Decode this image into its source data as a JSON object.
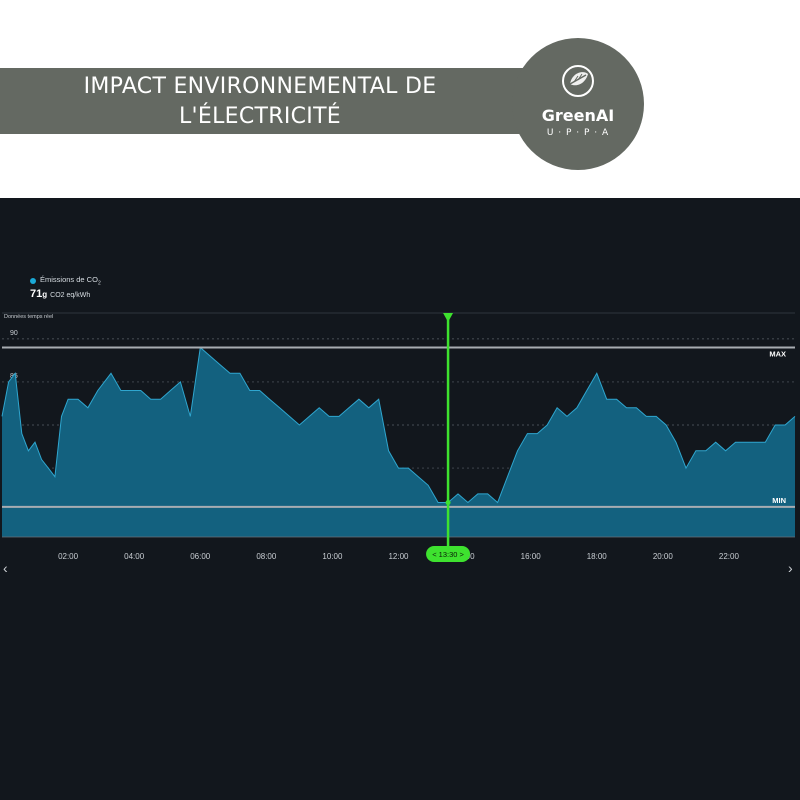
{
  "header": {
    "title_line1": "IMPACT ENVIRONNEMENTAL DE",
    "title_line2": "L'ÉLECTRICITÉ"
  },
  "logo": {
    "name": "GreenAI",
    "sub": "U · P · P · A",
    "icon": "leaf-globe-icon"
  },
  "legend": {
    "label": "Émissions de CO",
    "label_sub": "2",
    "value": "71",
    "value_unit_g": "g",
    "unit": "CO2 eq/kWh",
    "color": "#1aa9d6"
  },
  "live_label": "Données temps réel",
  "nav": {
    "prev": "‹",
    "next": "›"
  },
  "chart_data": {
    "type": "area",
    "title": "",
    "ylabel": "",
    "xlabel": "",
    "ylim": [
      67,
      93
    ],
    "xlim": [
      0,
      24
    ],
    "yticks": [
      70,
      75,
      80,
      85,
      90
    ],
    "xticks": [
      {
        "x": 2,
        "label": "02:00"
      },
      {
        "x": 4,
        "label": "04:00"
      },
      {
        "x": 6,
        "label": "06:00"
      },
      {
        "x": 8,
        "label": "08:00"
      },
      {
        "x": 10,
        "label": "10:00"
      },
      {
        "x": 12,
        "label": "12:00"
      },
      {
        "x": 14,
        "label": "14:00"
      },
      {
        "x": 16,
        "label": "16:00"
      },
      {
        "x": 18,
        "label": "18:00"
      },
      {
        "x": 20,
        "label": "20:00"
      },
      {
        "x": 22,
        "label": "22:00"
      }
    ],
    "max_line": {
      "value": 89,
      "label": "MAX"
    },
    "min_line": {
      "value": 70.5,
      "label": "MIN"
    },
    "cursor": {
      "x": 13.5,
      "label": "< 13:30 >",
      "value": 71
    },
    "grid": true,
    "colors": {
      "area": "#13617f",
      "line": "#2fa6cf",
      "cursor": "#3ee22f",
      "ref": "#9aa0a6"
    },
    "series": [
      {
        "name": "Émissions de CO2",
        "x": [
          0,
          0.2,
          0.4,
          0.6,
          0.8,
          1.0,
          1.2,
          1.4,
          1.6,
          1.8,
          2.0,
          2.3,
          2.6,
          2.9,
          3.3,
          3.6,
          3.9,
          4.2,
          4.5,
          4.8,
          5.1,
          5.4,
          5.7,
          6.0,
          6.3,
          6.6,
          6.9,
          7.2,
          7.5,
          7.8,
          8.1,
          8.4,
          8.7,
          9.0,
          9.3,
          9.6,
          9.9,
          10.2,
          10.5,
          10.8,
          11.1,
          11.4,
          11.7,
          12.0,
          12.3,
          12.6,
          12.9,
          13.2,
          13.5,
          13.8,
          14.1,
          14.4,
          14.7,
          15.0,
          15.3,
          15.6,
          15.9,
          16.2,
          16.5,
          16.8,
          17.1,
          17.4,
          17.7,
          18.0,
          18.3,
          18.6,
          18.9,
          19.2,
          19.5,
          19.8,
          20.1,
          20.4,
          20.7,
          21.0,
          21.3,
          21.6,
          21.9,
          22.2,
          22.5,
          22.8,
          23.1,
          23.4,
          23.7,
          24.0
        ],
        "values": [
          81,
          85,
          86,
          79,
          77,
          78,
          76,
          75,
          74,
          81,
          83,
          83,
          82,
          84,
          86,
          84,
          84,
          84,
          83,
          83,
          84,
          85,
          81,
          89,
          88,
          87,
          86,
          86,
          84,
          84,
          83,
          82,
          81,
          80,
          81,
          82,
          81,
          81,
          82,
          83,
          82,
          83,
          77,
          75,
          75,
          74,
          73,
          71,
          71,
          72,
          71,
          72,
          72,
          71,
          74,
          77,
          79,
          79,
          80,
          82,
          81,
          82,
          84,
          86,
          83,
          83,
          82,
          82,
          81,
          81,
          80,
          78,
          75,
          77,
          77,
          78,
          77,
          78,
          78,
          78,
          78,
          80,
          80,
          81
        ]
      }
    ]
  }
}
